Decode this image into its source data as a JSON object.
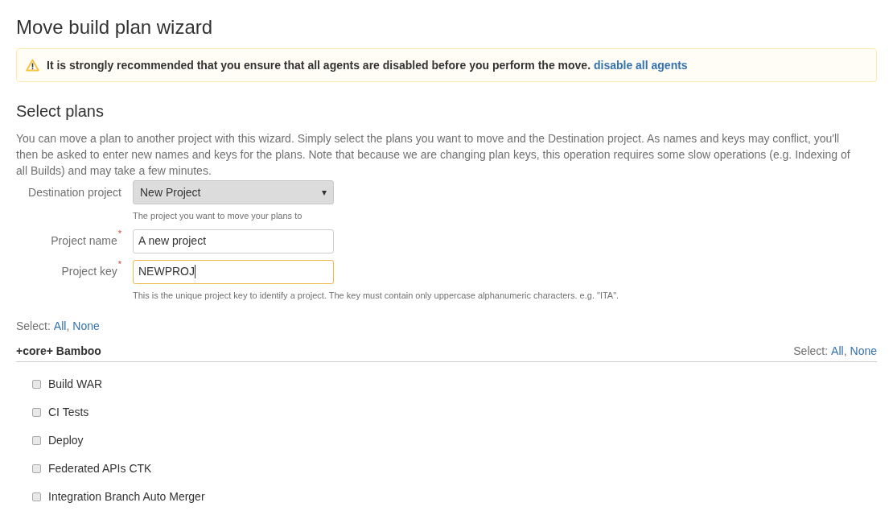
{
  "page": {
    "title": "Move build plan wizard"
  },
  "warning": {
    "text": "It is strongly recommended that you ensure that all agents are disabled before you perform the move.",
    "link": "disable all agents"
  },
  "section": {
    "title": "Select plans",
    "description": "You can move a plan to another project with this wizard. Simply select the plans you want to move and the Destination project. As names and keys may conflict, you'll then be asked to enter new names and keys for the plans. Note that because we are changing plan keys, this operation requires some slow operations (e.g. Indexing of all Builds) and may take a few minutes."
  },
  "form": [
    {
      "kind": "select",
      "label": "Destination project",
      "value": "New Project",
      "caret": "▾",
      "hint": "The project you want to move your plans to"
    },
    {
      "kind": "text",
      "label": "Project name",
      "required_mark": "*",
      "value": "A new project",
      "focused": false
    },
    {
      "kind": "text",
      "label": "Project key",
      "required_mark": "*",
      "value": "NEWPROJ",
      "focused": true,
      "hint": "This is the unique project key to identify a project. The key must contain only uppercase alphanumeric characters. e.g. \"ITA\"."
    }
  ],
  "select_all": {
    "label": "Select:",
    "all": "All",
    "separator": ",",
    "none": "None"
  },
  "project_group": {
    "name": "+core+ Bamboo",
    "select_label": "Select:",
    "all": "All",
    "separator": ",",
    "none": "None",
    "plans": [
      {
        "label": "Build WAR",
        "checked": false
      },
      {
        "label": "CI Tests",
        "checked": false
      },
      {
        "label": "Deploy",
        "checked": false
      },
      {
        "label": "Federated APIs CTK",
        "checked": false
      },
      {
        "label": "Integration Branch Auto Merger",
        "checked": false
      }
    ]
  }
}
